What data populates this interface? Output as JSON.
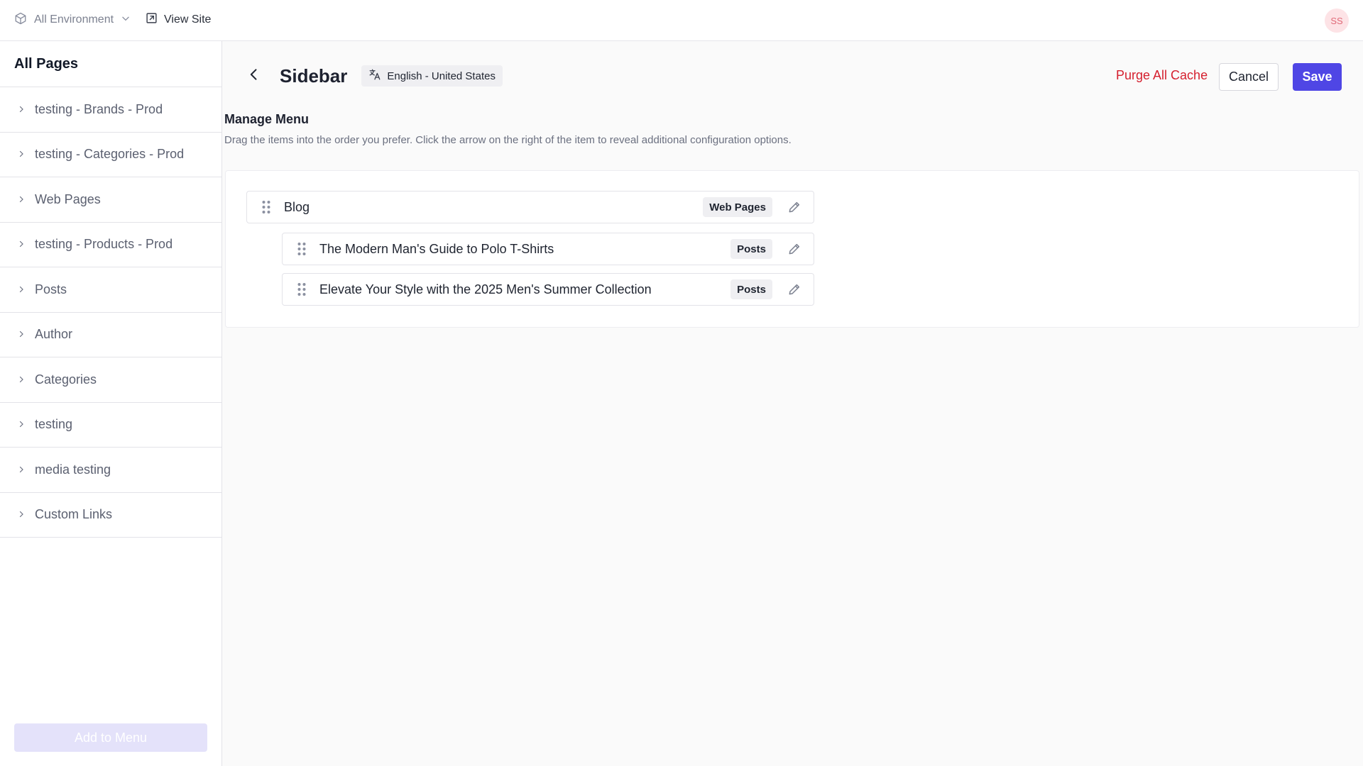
{
  "topbar": {
    "environment_label": "All Environment",
    "view_site_label": "View Site",
    "avatar_initials": "SS"
  },
  "left_panel": {
    "title": "All Pages",
    "items": [
      {
        "label": "testing - Brands - Prod"
      },
      {
        "label": "testing - Categories - Prod"
      },
      {
        "label": "Web Pages"
      },
      {
        "label": "testing - Products - Prod"
      },
      {
        "label": "Posts"
      },
      {
        "label": "Author"
      },
      {
        "label": "Categories"
      },
      {
        "label": "testing"
      },
      {
        "label": "media testing"
      },
      {
        "label": "Custom Links"
      }
    ],
    "add_button_label": "Add to Menu"
  },
  "header": {
    "title": "Sidebar",
    "language": "English - United States",
    "purge_label": "Purge All Cache",
    "cancel_label": "Cancel",
    "save_label": "Save"
  },
  "manage_menu": {
    "title": "Manage Menu",
    "description": "Drag the items into the order you prefer. Click the arrow on the right of the item to reveal additional configuration options.",
    "items": [
      {
        "label": "Blog",
        "type": "Web Pages",
        "level": 0
      },
      {
        "label": "The Modern Man's Guide to Polo T-Shirts",
        "type": "Posts",
        "level": 1
      },
      {
        "label": "Elevate Your Style with the 2025 Men's Summer Collection",
        "type": "Posts",
        "level": 1
      }
    ]
  },
  "colors": {
    "accent": "#4f46e5",
    "danger": "#d51f2e",
    "avatar_bg": "#fde3e6"
  },
  "icons": {
    "environment": "cube-icon",
    "view_site": "external-link-icon",
    "back": "chevron-left-icon",
    "language": "translate-icon",
    "drag": "drag-handle-icon",
    "edit": "pencil-icon",
    "expand": "chevron-right-icon"
  }
}
